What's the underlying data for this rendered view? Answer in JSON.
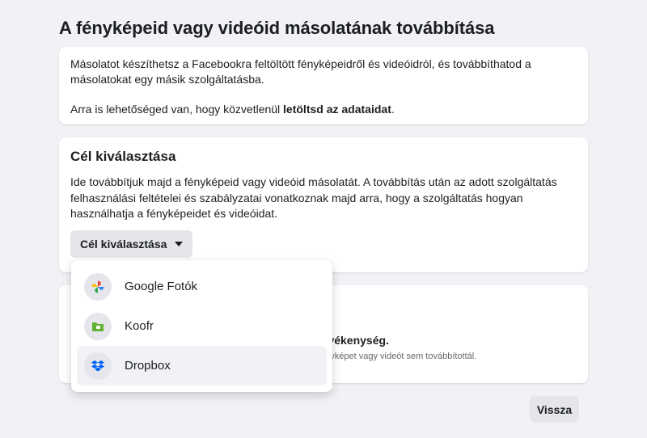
{
  "page": {
    "title": "A fényképeid vagy videóid másolatának továbbítása"
  },
  "intro": {
    "paragraph1": "Másolatot készíthetsz a Facebookra feltöltött fényképeidről és videóidról, és továbbíthatod a másolatokat egy másik szolgáltatásba.",
    "paragraph2_prefix": "Arra is lehetőséged van, hogy közvetlenül ",
    "paragraph2_link": "letöltsd az adataidat",
    "paragraph2_suffix": "."
  },
  "destination": {
    "heading": "Cél kiválasztása",
    "description": "Ide továbbítjuk majd a fényképeid vagy videóid másolatát. A továbbítás után az adott szolgáltatás felhasználási feltételei és szabályzatai vonatkoznak majd arra, hogy a szolgáltatás hogyan használhatja a fényképeidet és videóidat.",
    "select_label": "Cél kiválasztása"
  },
  "dropdown": {
    "options": [
      {
        "label": "Google Fotók",
        "icon": "google-photos-icon"
      },
      {
        "label": "Koofr",
        "icon": "koofr-icon"
      },
      {
        "label": "Dropbox",
        "icon": "dropbox-icon",
        "highlighted": true
      }
    ]
  },
  "activity": {
    "title_fragment": "tevékenység.",
    "subtitle_fragment": "fényképet vagy videót sem továbbítottál."
  },
  "footer": {
    "back_label": "Vissza"
  },
  "colors": {
    "background": "#f0f2f5",
    "card": "#ffffff",
    "button_gray": "#e4e6eb",
    "dropbox_blue": "#0061fe",
    "koofr_green": "#5fb233"
  }
}
